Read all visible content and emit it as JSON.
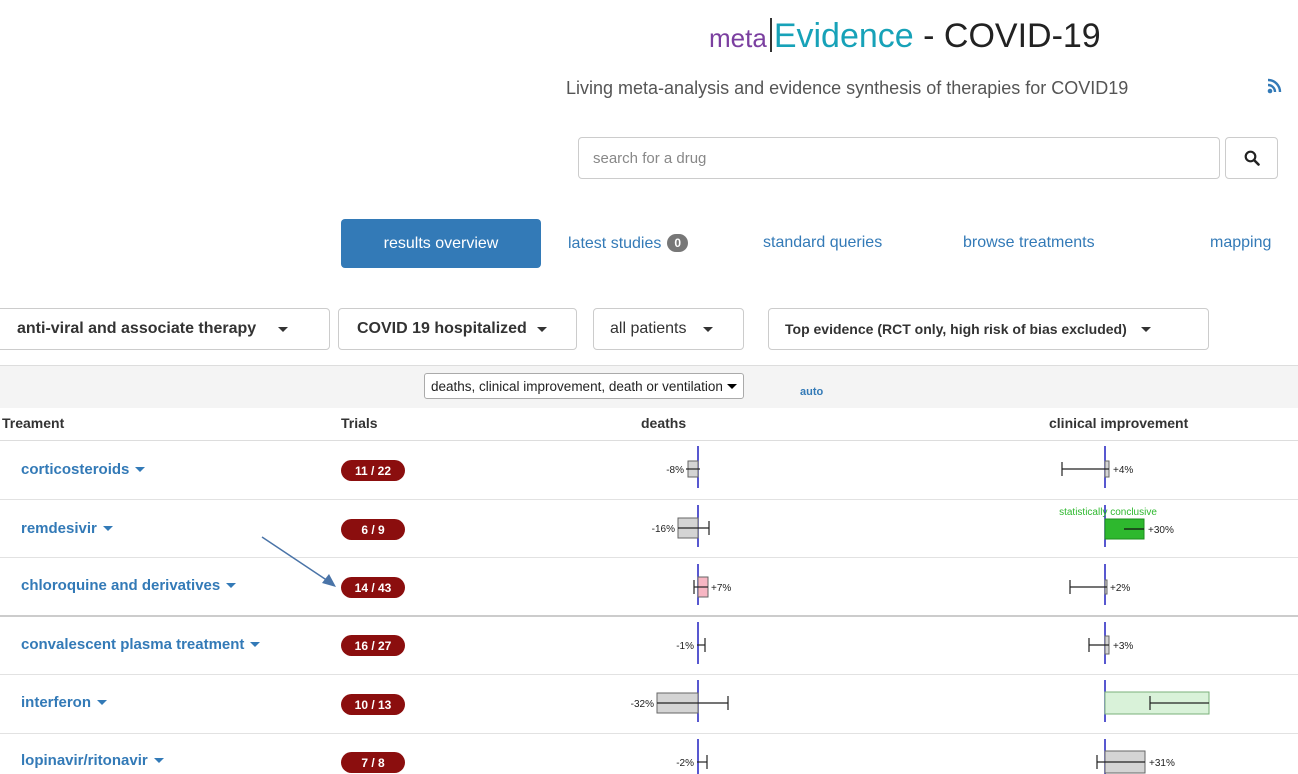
{
  "header": {
    "brand_meta": "meta",
    "brand_evidence": "Evidence",
    "brand_rest": " - COVID-19",
    "subtitle": "Living meta-analysis and evidence synthesis of therapies for COVID19"
  },
  "search": {
    "placeholder": "search for a drug",
    "button_icon": "search-icon"
  },
  "nav": {
    "results_overview": "results overview",
    "latest_studies": "latest studies",
    "latest_studies_count": "0",
    "standard_queries": "standard queries",
    "browse_treatments": "browse treatments",
    "mapping": "mapping"
  },
  "filters": {
    "therapy": "anti-viral and associate therapy",
    "population": "COVID 19 hospitalized",
    "patients": "all patients",
    "evidence": "Top evidence (RCT only, high risk of bias excluded)"
  },
  "table": {
    "outcomes_select": "deaths, clinical improvement, death or ventilation",
    "auto": "auto",
    "col_treatment": "Treament",
    "col_trials": "Trials",
    "col_deaths": "deaths",
    "col_clinical": "clinical improvement",
    "conclusive_label": "statistically conclusive",
    "rows": [
      {
        "name": "corticosteroids",
        "trials": "11 / 22",
        "deaths_label": "-8%",
        "deaths_value": -8,
        "clin_label": "+4%",
        "clin_value": 4
      },
      {
        "name": "remdesivir",
        "trials": "6 / 9",
        "deaths_label": "-16%",
        "deaths_value": -16,
        "clin_label": "+30%",
        "clin_value": 30
      },
      {
        "name": "chloroquine and derivatives",
        "trials": "14 / 43",
        "deaths_label": "+7%",
        "deaths_value": 7,
        "clin_label": "+2%",
        "clin_value": 2
      },
      {
        "name": "convalescent plasma treatment",
        "trials": "16 / 27",
        "deaths_label": "-1%",
        "deaths_value": -1,
        "clin_label": "+3%",
        "clin_value": 3
      },
      {
        "name": "interferon",
        "trials": "10 / 13",
        "deaths_label": "-32%",
        "deaths_value": -32,
        "clin_label": "",
        "clin_value": null
      },
      {
        "name": "lopinavir/ritonavir",
        "trials": "7 / 8",
        "deaths_label": "-2%",
        "deaths_value": -2,
        "clin_label": "+31%",
        "clin_value": 31
      }
    ]
  },
  "colors": {
    "primary": "#337ab7",
    "badge": "#8b0e0e",
    "brand_meta": "#7b3fa0",
    "brand_evidence": "#17a2b8",
    "conclusive_green": "#2eb82e"
  }
}
